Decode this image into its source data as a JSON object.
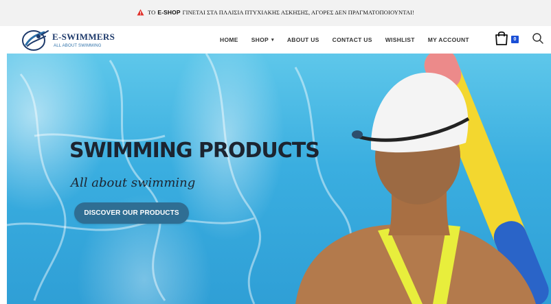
{
  "notice": {
    "prefix": "ΤΟ",
    "bold": "E-SHOP",
    "text": "ΓΙΝΕΤΑΙ ΣΤΑ ΠΛΑΙΣΙΑ ΠΤΥΧΙΑΚΗΣ ΑΣΚΗΣΗΣ, ΑΓΟΡΕΣ ΔΕΝ ΠΡΑΓΜΑΤΟΠΟΙΟΥΝΤΑΙ!",
    "icon": "warning-icon",
    "icon_color": "#e0302a"
  },
  "brand": {
    "name": "E-SWIMMERS",
    "tagline": "ALL ABOUT SWIMMING",
    "logo_icon": "swimmer-logo-icon",
    "color": "#1e3a6b"
  },
  "nav": {
    "items": [
      {
        "label": "HOME"
      },
      {
        "label": "SHOP",
        "caret": "▾"
      },
      {
        "label": "ABOUT US"
      },
      {
        "label": "CONTACT US"
      },
      {
        "label": "WISHLIST"
      },
      {
        "label": "MY ACCOUNT"
      }
    ]
  },
  "cart": {
    "icon": "shopping-bag-icon",
    "count": "0",
    "badge_color": "#1a4fd6"
  },
  "search": {
    "icon": "search-icon"
  },
  "hero": {
    "title": "SWIMMING PRODUCTS",
    "subtitle": "All about swimming",
    "cta_label": "DISCOVER OUR PRODUCTS",
    "cta_color": "#2f6e93",
    "water_color": "#3aaee0"
  }
}
